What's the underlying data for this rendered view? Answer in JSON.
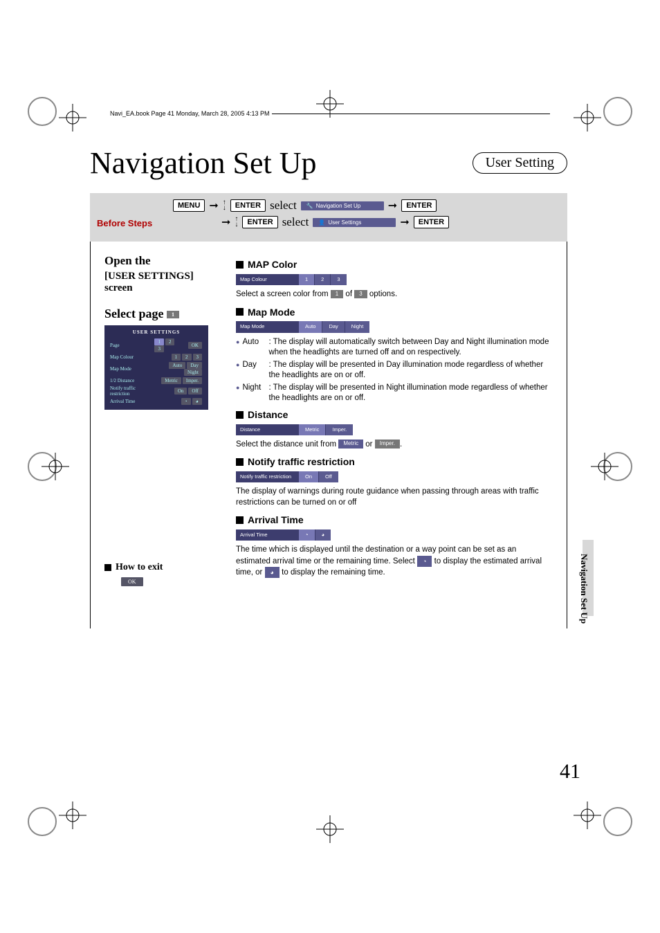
{
  "bookline": "Navi_EA.book  Page 41  Monday, March 28, 2005  4:13 PM",
  "title": "Navigation Set Up",
  "pill": "User Setting",
  "before_steps": {
    "label": "Before Steps",
    "menu": "MENU",
    "enter": "ENTER",
    "select": "select",
    "chip1": "Navigation Set Up",
    "chip2": "User Settings"
  },
  "left": {
    "open1": "Open the",
    "open2": "[USER SETTINGS]",
    "open3": "screen",
    "selectpage": "Select page",
    "page_chip": "1",
    "mini": {
      "title": "USER SETTINGS",
      "rows": [
        {
          "l": "Page",
          "v": [
            "1",
            "2",
            "3"
          ],
          "r": "OK"
        },
        {
          "l": "Map Colour",
          "v": [
            "1",
            "2",
            "3"
          ],
          "r": ""
        },
        {
          "l": "Map Mode",
          "v": [
            "Auto",
            "Day",
            "Night"
          ],
          "r": ""
        },
        {
          "l": "1/2  Distance",
          "v": [
            "Metric",
            "Imper."
          ],
          "r": ""
        },
        {
          "l": "Notify traffic restriction",
          "v": [
            "On",
            "Off"
          ],
          "r": ""
        },
        {
          "l": "Arrival Time",
          "v": [
            "◔",
            "◕"
          ],
          "r": ""
        }
      ]
    },
    "howexit": "How to exit",
    "ok": "OK"
  },
  "sections": {
    "mapcolor": {
      "head": "MAP Color",
      "bar_label": "Map Colour",
      "opts": [
        "1",
        "2",
        "3"
      ],
      "desc_a": "Select a screen color from ",
      "desc_b": " of ",
      "desc_c": " options.",
      "chip1": "1",
      "chip3": "3"
    },
    "mapmode": {
      "head": "Map Mode",
      "bar_label": "Map Mode",
      "opts": [
        "Auto",
        "Day",
        "Night"
      ],
      "auto_l": "Auto",
      "auto_t": ": The display will automatically switch between Day and Night illumination mode when the headlights are turned off and on respectively.",
      "day_l": "Day",
      "day_t": ": The display will be presented in Day illumination mode regardless of whether the headlights are on or off.",
      "night_l": "Night",
      "night_t": ": The display will be presented in Night illumination mode regardless of whether the headlights are on or off."
    },
    "distance": {
      "head": "Distance",
      "bar_label": "Distance",
      "opts": [
        "Metric",
        "Imper."
      ],
      "desc_a": "Select the distance unit from ",
      "desc_b": " or ",
      "desc_c": ".",
      "chipM": "Metric",
      "chipI": "Imper."
    },
    "notify": {
      "head": "Notify traffic restriction",
      "bar_label": "Notify traffic restriction",
      "opts": [
        "On",
        "Off"
      ],
      "desc": "The display of warnings during route guidance when passing through areas with traffic restrictions can be turned on or off"
    },
    "arrival": {
      "head": "Arrival Time",
      "bar_label": "Arrival Time",
      "opts": [
        "◔",
        "◕"
      ],
      "desc_a": "The time which is displayed until the destination or a way point can be set as an estimated arrival time or the remaining time. Select ",
      "desc_b": " to display the estimated arrival time, or ",
      "desc_c": " to display the remaining time.",
      "chipA": "◔",
      "chipB": "◕"
    }
  },
  "side_tab": "Navigation Set Up",
  "page_number": "41"
}
